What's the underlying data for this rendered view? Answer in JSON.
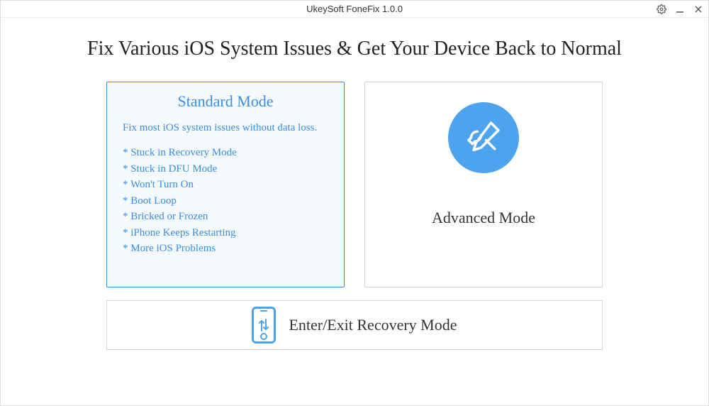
{
  "window": {
    "title": "UkeySoft FoneFix 1.0.0"
  },
  "headline": "Fix Various iOS System Issues & Get Your Device Back to Normal",
  "standard": {
    "title": "Standard Mode",
    "desc": "Fix most iOS system issues without data loss.",
    "items": [
      "Stuck in Recovery Mode",
      "Stuck in DFU Mode",
      "Won't Turn On",
      "Boot Loop",
      "Bricked or Frozen",
      "iPhone Keeps Restarting",
      "More iOS Problems"
    ]
  },
  "advanced": {
    "title": "Advanced Mode"
  },
  "recovery": {
    "label": "Enter/Exit Recovery Mode"
  }
}
